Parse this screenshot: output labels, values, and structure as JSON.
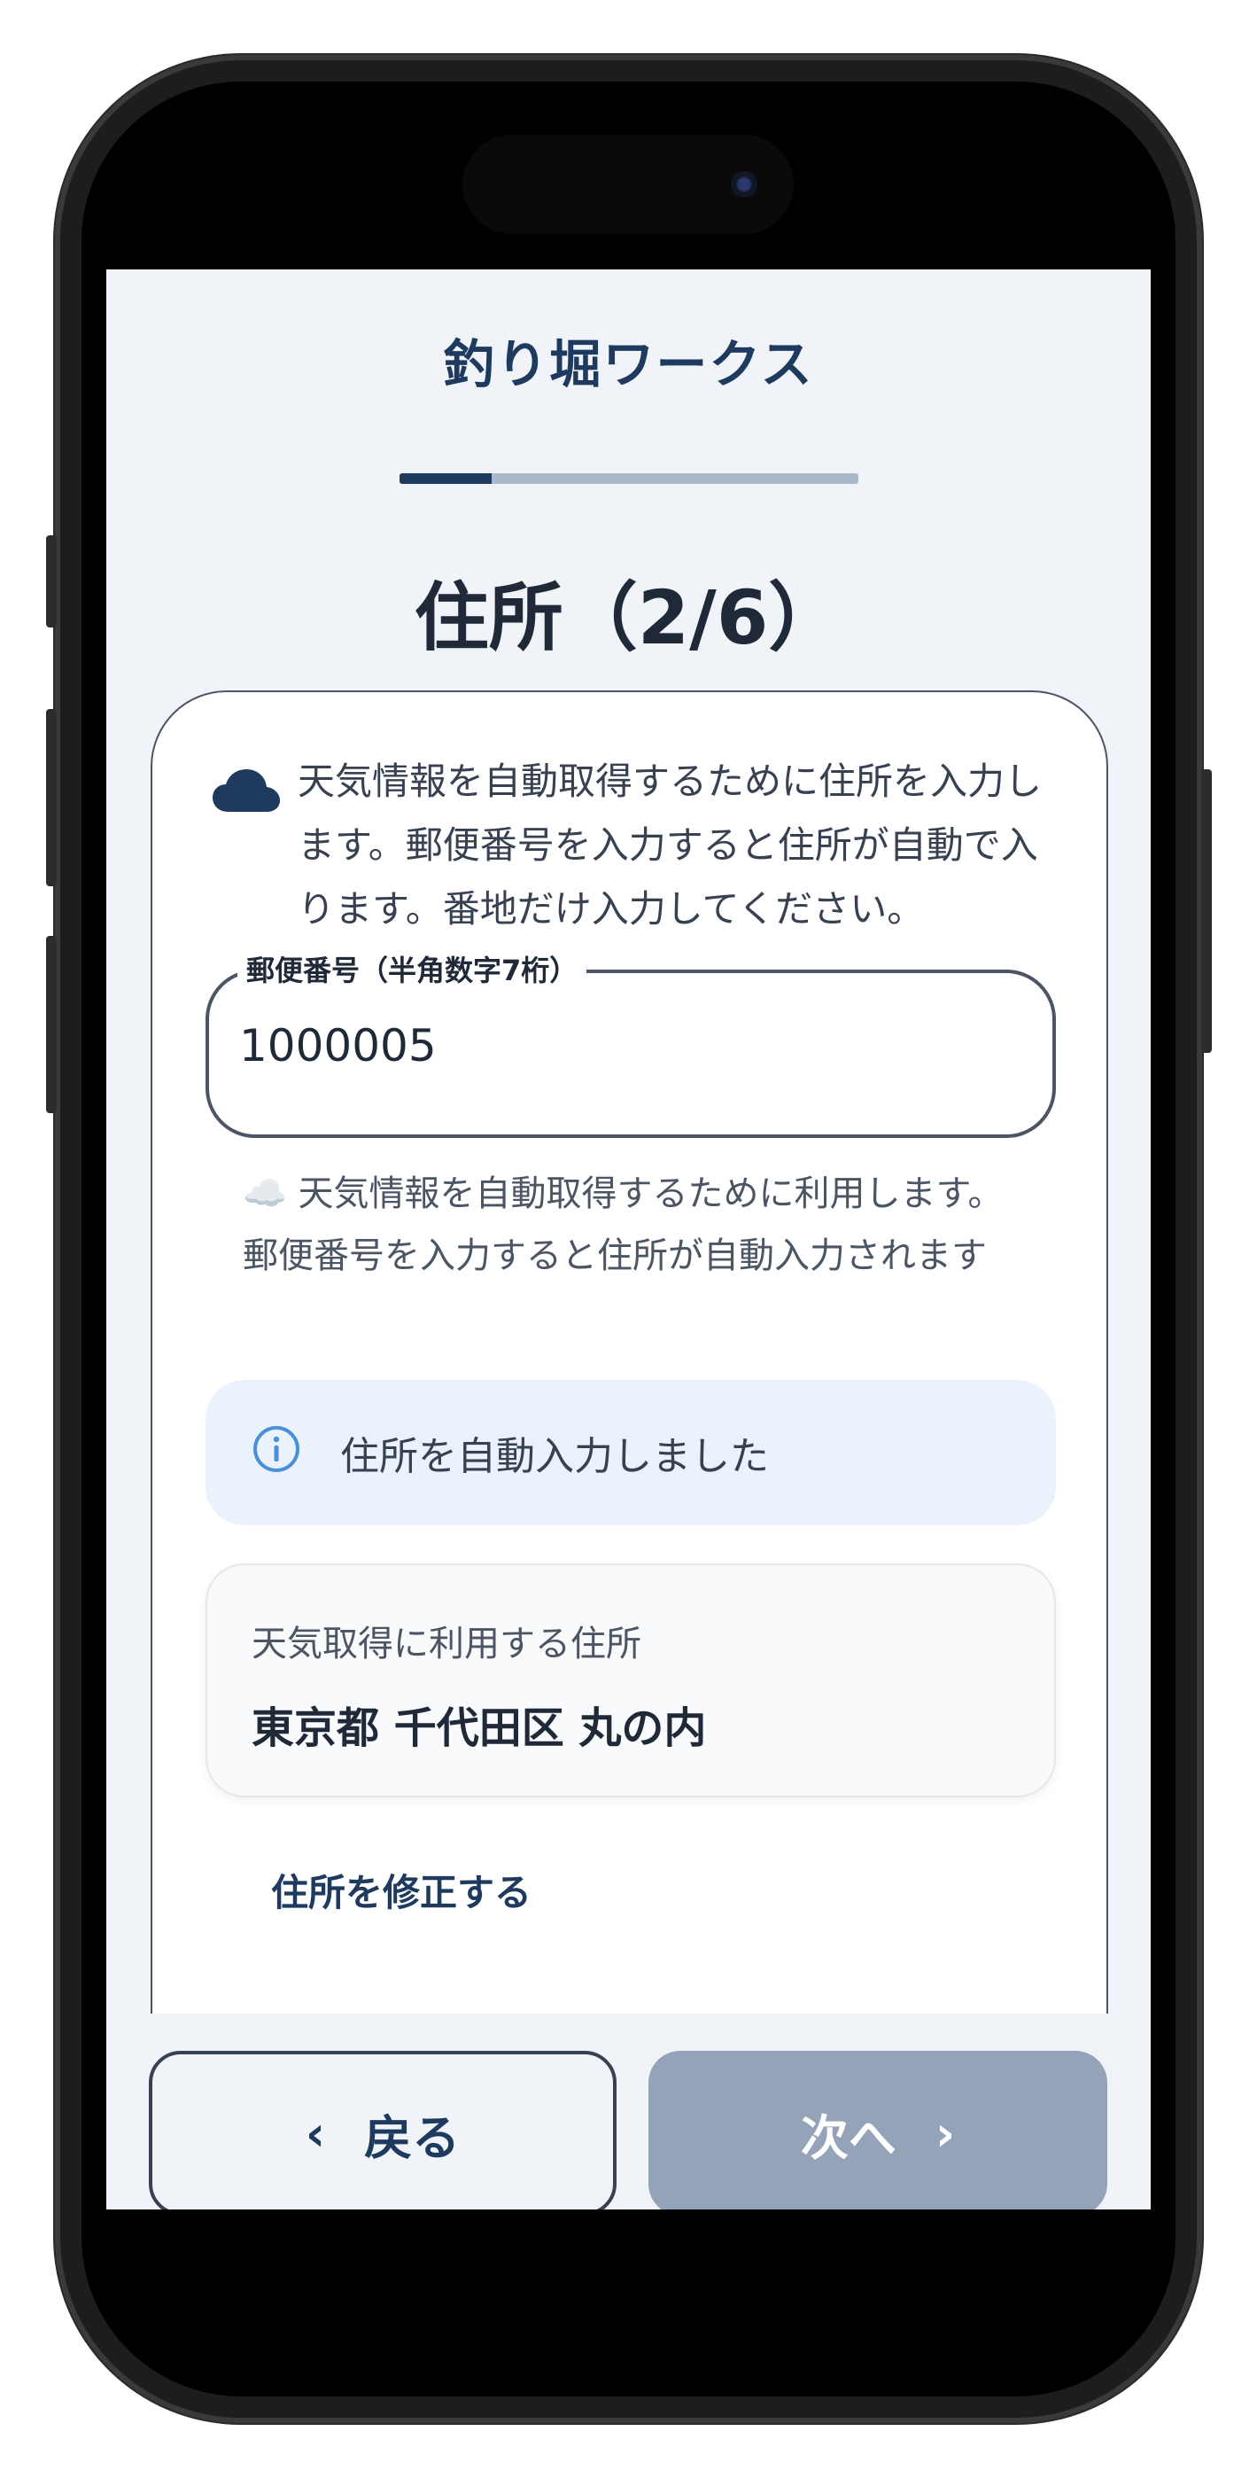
{
  "app": {
    "title": "釣り堀ワークス"
  },
  "progress": {
    "current_step": 2,
    "total_steps": 6,
    "fraction": 0.2
  },
  "step": {
    "title": "住所（2/6）"
  },
  "intro": {
    "icon": "cloud-icon",
    "text": "天気情報を自動取得するために住所を入力します。郵便番号を入力すると住所が自動で入ります。番地だけ入力してください。"
  },
  "postal_field": {
    "label": "郵便番号（半角数字7桁）",
    "value": "1000005",
    "helper_icon": "☁️",
    "helper": "天気情報を自動取得するために利用します。郵便番号を入力すると住所が自動入力されます"
  },
  "alert": {
    "icon": "info-icon",
    "text": "住所を自動入力しました"
  },
  "summary": {
    "label": "天気取得に利用する住所",
    "value": "東京都 千代田区 丸の内"
  },
  "edit_link": {
    "label": "住所を修正する"
  },
  "nav": {
    "back_label": "戻る",
    "back_icon": "‹",
    "next_label": "次へ",
    "next_icon": "›"
  },
  "colors": {
    "brand": "#1e3a5f",
    "background": "#f0f4f8",
    "next_disabled": "#94a3b8",
    "alert_bg": "#eaf3fd",
    "info_accent": "#4a90d9"
  }
}
